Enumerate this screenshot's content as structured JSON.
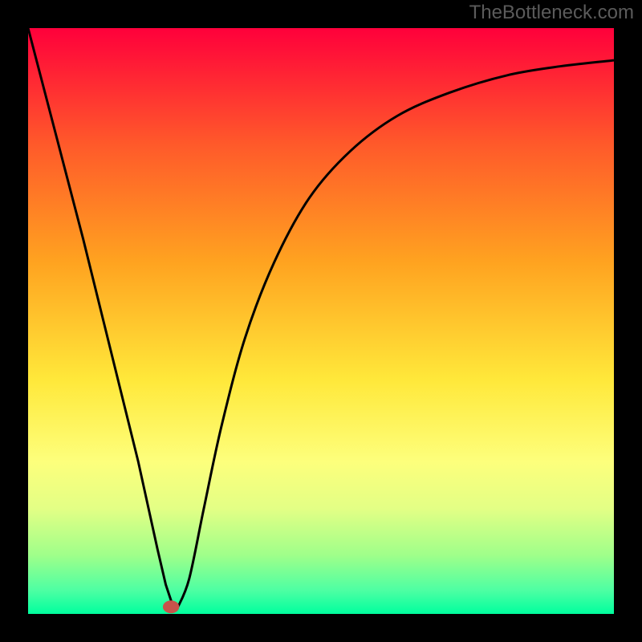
{
  "watermark": "TheBottleneck.com",
  "chart_data": {
    "type": "line",
    "title": "",
    "xlabel": "",
    "ylabel": "",
    "xlim": [
      0,
      1
    ],
    "ylim": [
      0,
      1
    ],
    "grid": false,
    "legend": false,
    "background": {
      "gradient_stops": [
        {
          "offset": 0.0,
          "color": "#ff003b"
        },
        {
          "offset": 0.2,
          "color": "#ff5a2a"
        },
        {
          "offset": 0.4,
          "color": "#ffa320"
        },
        {
          "offset": 0.6,
          "color": "#ffe83a"
        },
        {
          "offset": 0.74,
          "color": "#fdff7c"
        },
        {
          "offset": 0.82,
          "color": "#e3ff85"
        },
        {
          "offset": 0.9,
          "color": "#9fff8a"
        },
        {
          "offset": 0.96,
          "color": "#4dffa3"
        },
        {
          "offset": 1.0,
          "color": "#00ff9e"
        }
      ]
    },
    "series": [
      {
        "name": "bottleneck-curve",
        "color": "#000000",
        "x": [
          0.0,
          0.047,
          0.094,
          0.141,
          0.188,
          0.221,
          0.235,
          0.245,
          0.255,
          0.275,
          0.3,
          0.33,
          0.37,
          0.42,
          0.48,
          0.55,
          0.63,
          0.72,
          0.82,
          0.91,
          1.0
        ],
        "y": [
          1.0,
          0.82,
          0.64,
          0.45,
          0.26,
          0.11,
          0.05,
          0.02,
          0.01,
          0.06,
          0.18,
          0.32,
          0.47,
          0.6,
          0.71,
          0.79,
          0.85,
          0.89,
          0.92,
          0.935,
          0.945
        ]
      }
    ],
    "markers": [
      {
        "name": "min-point",
        "x": 0.244,
        "y": 0.012,
        "color": "#c7534b",
        "r": 0.014
      }
    ]
  }
}
